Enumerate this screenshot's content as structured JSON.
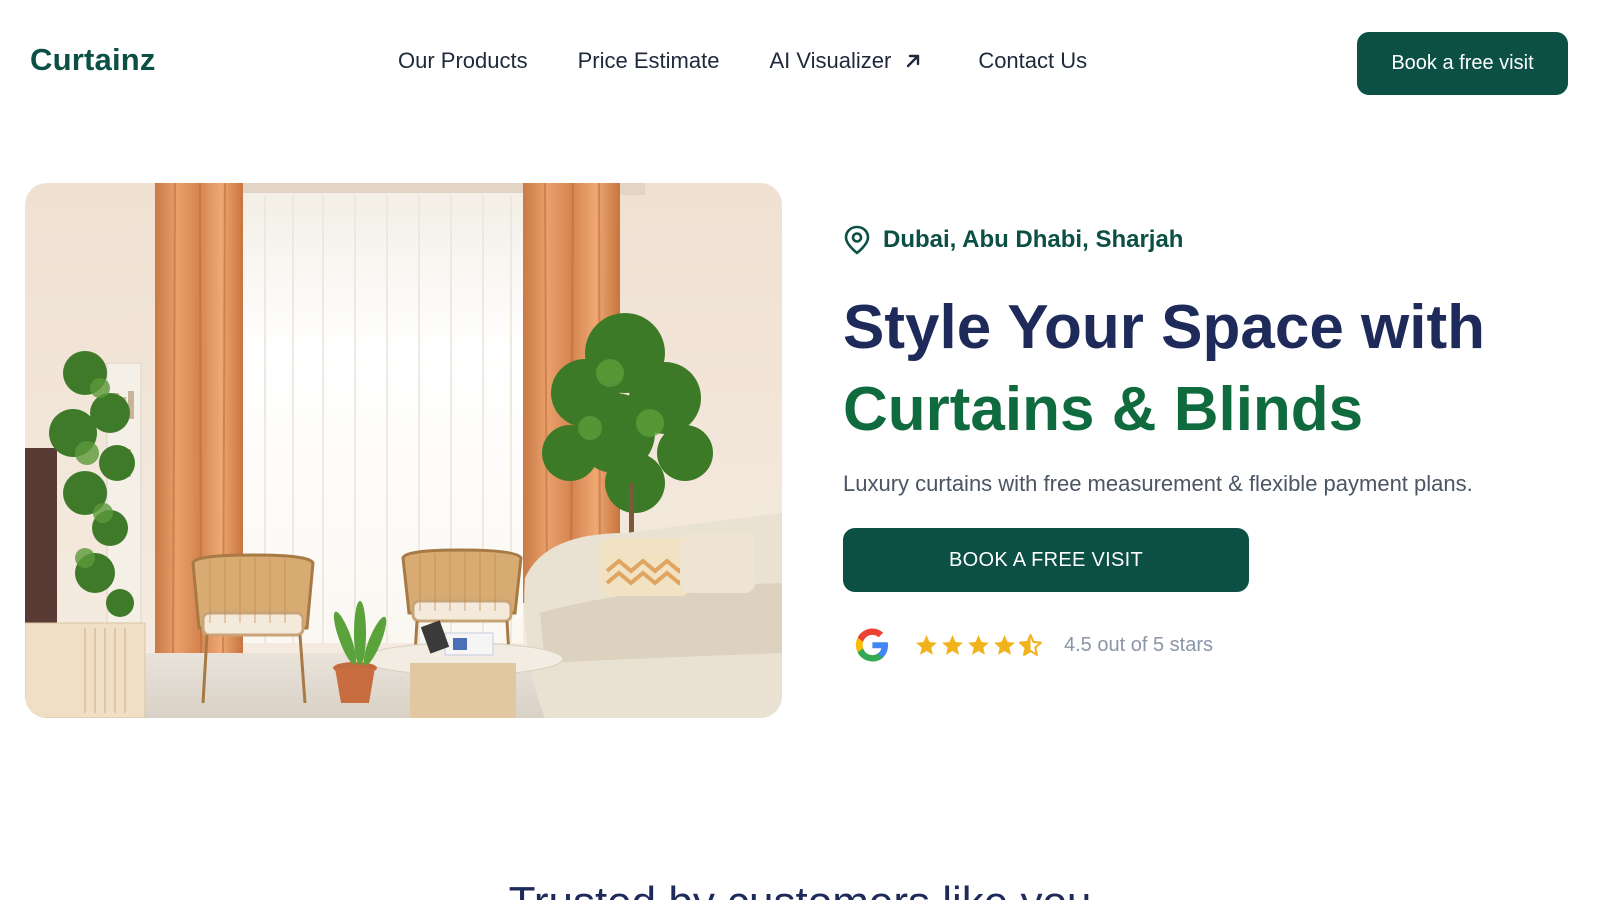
{
  "brand": {
    "logo_text": "Curtainz",
    "accent": "#0b4f45",
    "headline_navy": "#1e2a5a",
    "headline_green": "#0f6b3e",
    "star_color": "#f2b21b"
  },
  "nav": {
    "items": [
      {
        "label": "Our Products"
      },
      {
        "label": "Price Estimate"
      },
      {
        "label": "AI Visualizer",
        "icon": "arrow-up-right-icon"
      },
      {
        "label": "Contact Us"
      }
    ],
    "cta_label": "Book a free visit"
  },
  "hero": {
    "location_icon": "map-pin-icon",
    "location": "Dubai, Abu Dhabi, Sharjah",
    "headline_line1": "Style Your Space with",
    "headline_line2": "Curtains & Blinds",
    "subtext": "Luxury curtains with free measurement & flexible payment plans.",
    "cta_label": "BOOK A FREE VISIT",
    "rating": {
      "provider_icon": "google-icon",
      "stars_value": 4.5,
      "stars_max": 5,
      "text": "4.5 out of 5 stars"
    }
  },
  "trusted": {
    "title": "Trusted by customers like you"
  }
}
